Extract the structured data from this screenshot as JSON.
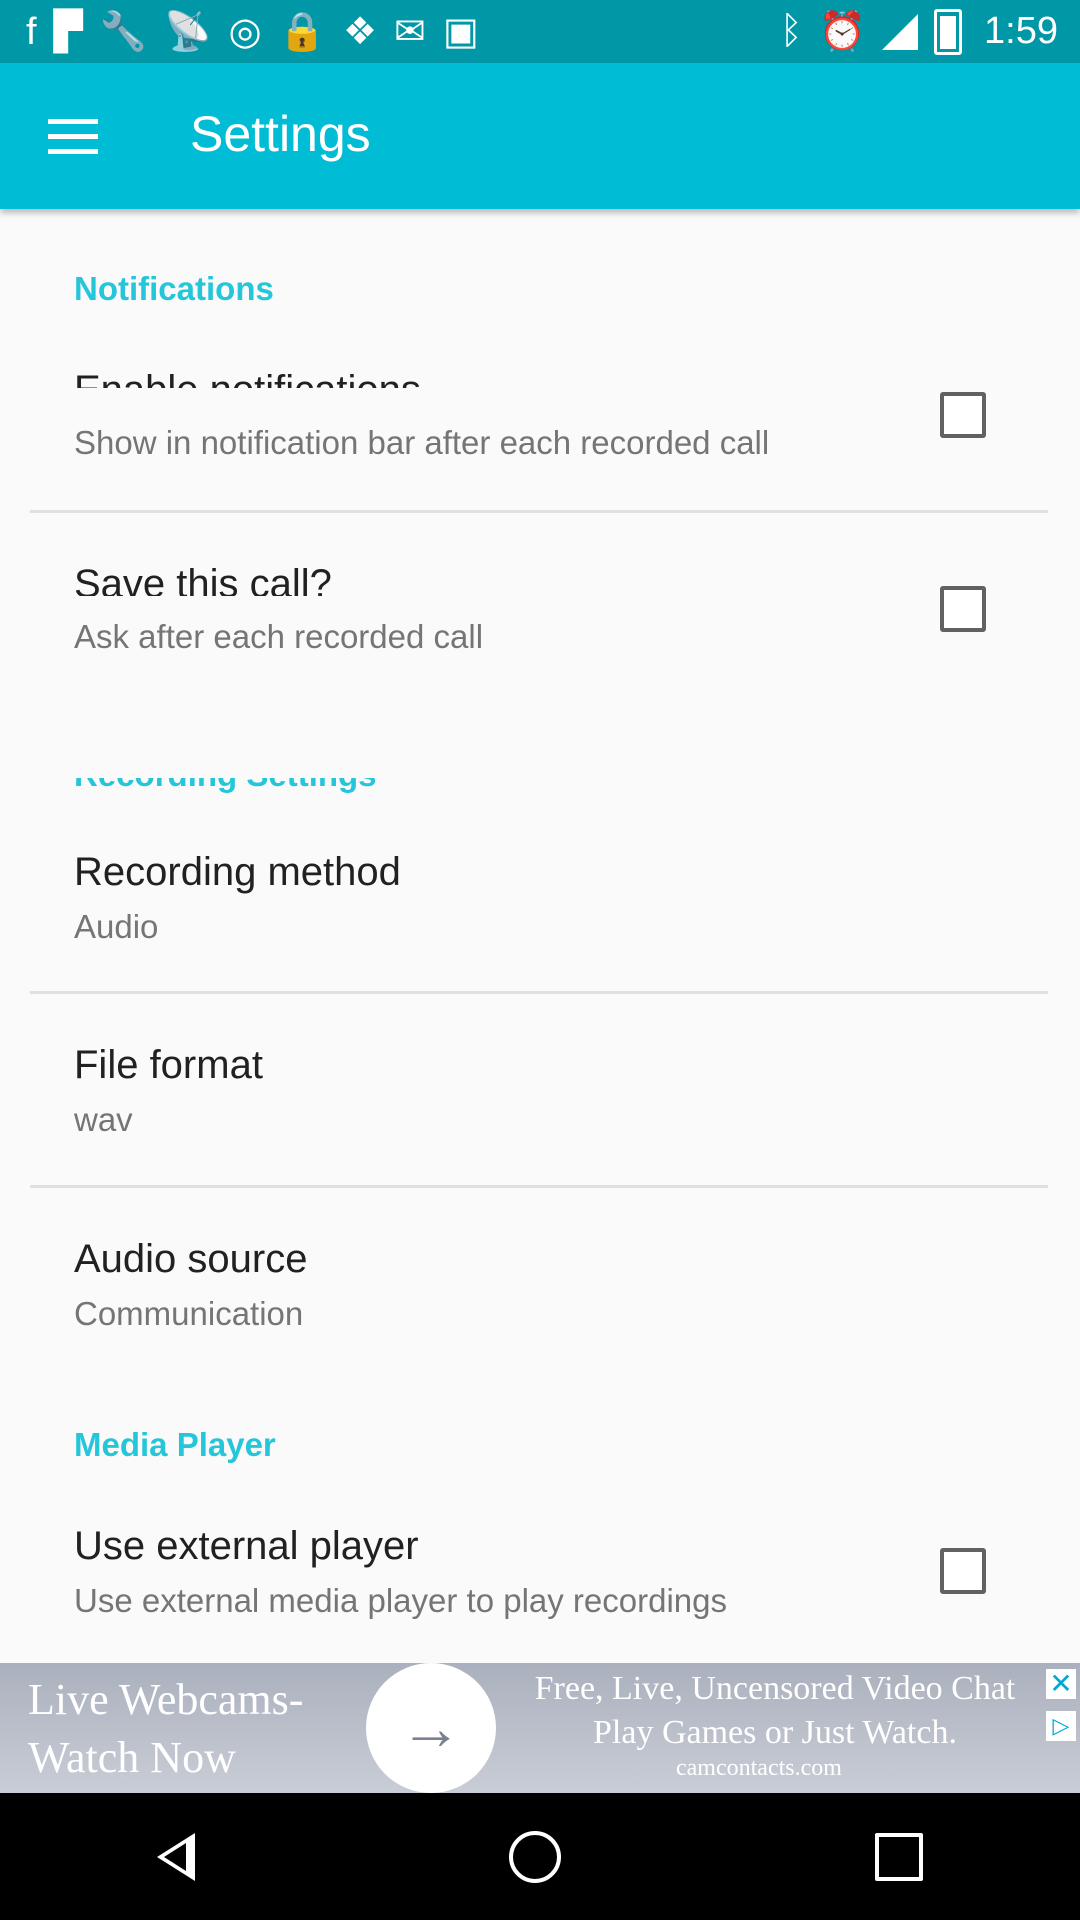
{
  "status_bar": {
    "time": "1:59",
    "left_icons": [
      "facebook-icon",
      "flipboard-icon",
      "wrench-icon",
      "satellite-icon",
      "vpn-icon",
      "lock-icon",
      "dropbox-icon",
      "inbox-icon",
      "briefcase-icon"
    ],
    "right_icons": [
      "bluetooth-icon",
      "alarm-icon",
      "signal-icon",
      "battery-icon"
    ]
  },
  "app_bar": {
    "title": "Settings"
  },
  "sections": {
    "notifications": "Notifications",
    "recording": "Recording Settings",
    "media_player": "Media Player"
  },
  "items": {
    "enable_notifications": {
      "title": "Enable notifications",
      "subtitle": "Show in notification bar after each recorded call",
      "checked": false
    },
    "save_call": {
      "title": "Save this call?",
      "subtitle": "Ask after each recorded call",
      "checked": false
    },
    "recording_method": {
      "title": "Recording method",
      "subtitle": "Audio"
    },
    "file_format": {
      "title": "File format",
      "subtitle": "wav"
    },
    "audio_source": {
      "title": "Audio source",
      "subtitle": "Communication"
    },
    "use_external_player": {
      "title": "Use external player",
      "subtitle": "Use external media player to play recordings",
      "checked": false
    }
  },
  "ad": {
    "left_line1": "Live Webcams-",
    "left_line2": "Watch Now",
    "right_line1": "Free, Live, Uncensored Video Chat",
    "right_line2": "Play Games or Just Watch.",
    "domain": "camcontacts.com"
  },
  "colors": {
    "status_bar": "#0097a7",
    "app_bar": "#00bcd4",
    "accent": "#26c6da"
  }
}
